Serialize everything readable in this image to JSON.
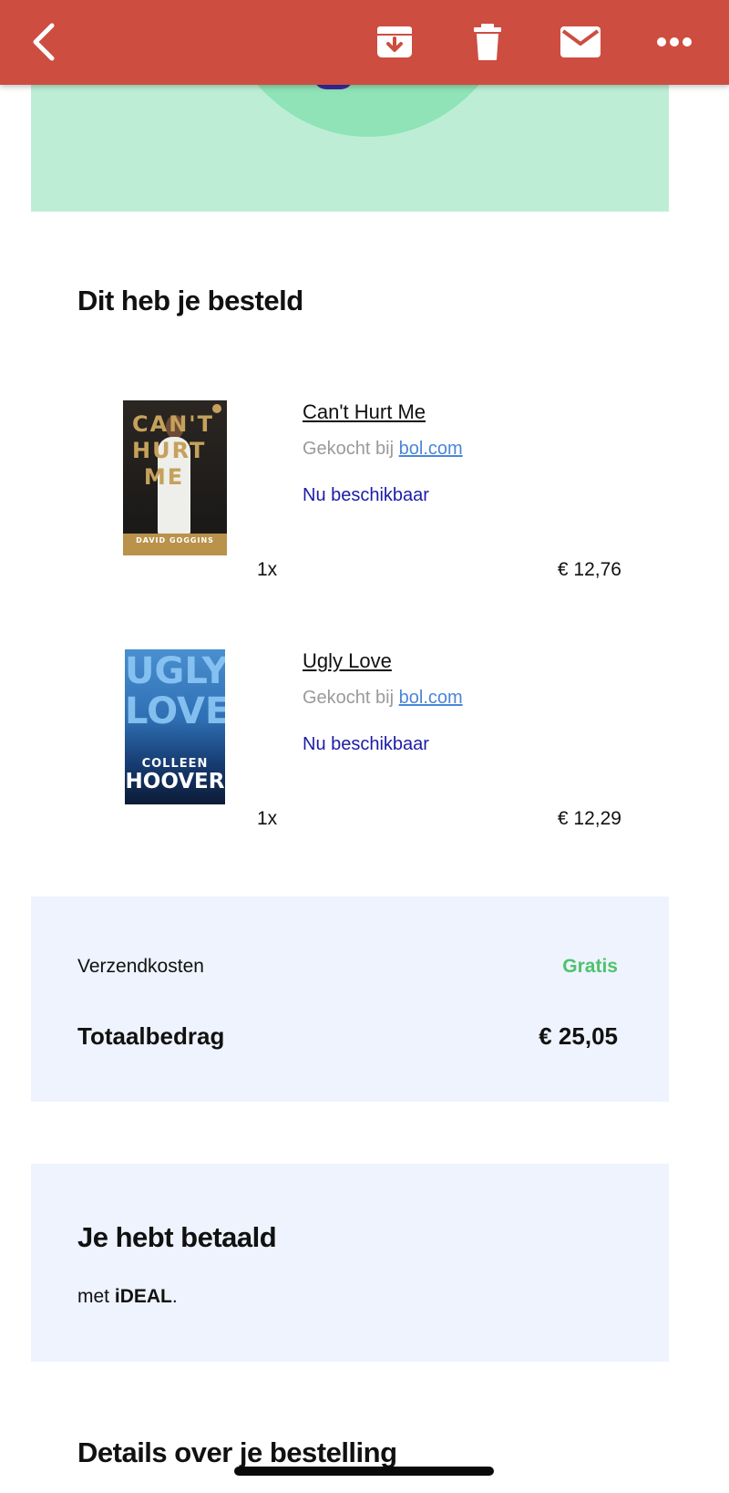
{
  "toolbar": {
    "back": "back",
    "archive": "archive",
    "delete": "delete",
    "mark_unread": "mark-unread",
    "more": "more"
  },
  "order": {
    "heading": "Dit heb je besteld",
    "items": [
      {
        "title": "Can't Hurt Me",
        "cover_title": "CAN'T HURT ME",
        "cover_author": "DAVID GOGGINS",
        "sold_prefix": "Gekocht bij",
        "seller": "bol.com",
        "availability": "Nu beschikbaar",
        "quantity": "1x",
        "price": "€ 12,76"
      },
      {
        "title": "Ugly Love",
        "cover_title": "UGLY LOVE",
        "cover_author_first": "COLLEEN",
        "cover_author_last": "HOOVER",
        "sold_prefix": "Gekocht bij",
        "seller": "bol.com",
        "availability": "Nu beschikbaar",
        "quantity": "1x",
        "price": "€ 12,29"
      }
    ]
  },
  "summary": {
    "shipping_label": "Verzendkosten",
    "shipping_value": "Gratis",
    "total_label": "Totaalbedrag",
    "total_value": "€ 25,05"
  },
  "payment": {
    "heading": "Je hebt betaald",
    "prefix": "met",
    "method": "iDEAL",
    "suffix": "."
  },
  "details": {
    "heading": "Details over je bestelling"
  },
  "colors": {
    "toolbar": "#cd4d41",
    "hero_bg": "#bdeed5",
    "summary_bg": "#eef3fd",
    "free_green": "#4fc26d",
    "availability_blue": "#1c1ca8",
    "link_blue": "#4a86d8"
  }
}
